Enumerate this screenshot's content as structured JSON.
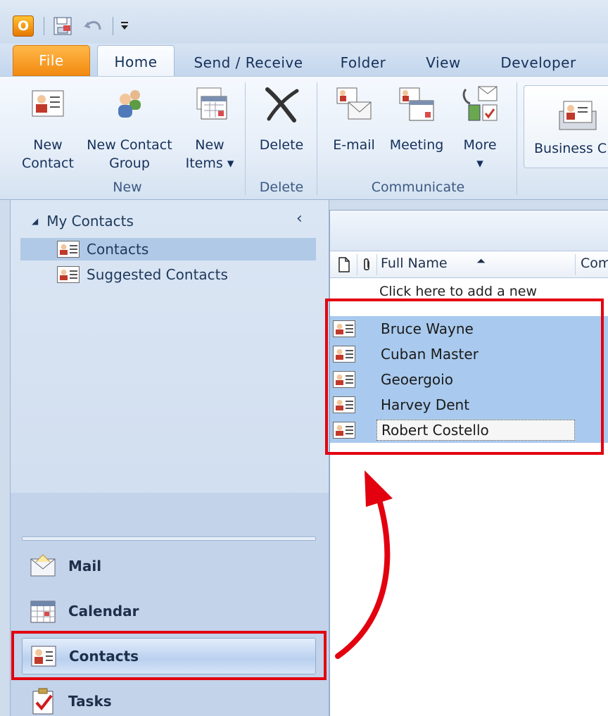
{
  "qat": {
    "app_icon": "outlook-logo-icon",
    "save_icon": "save-icon",
    "undo_icon": "undo-icon",
    "customize_icon": "customize-arrow-icon"
  },
  "tabs": [
    {
      "label": "File"
    },
    {
      "label": "Home"
    },
    {
      "label": "Send / Receive"
    },
    {
      "label": "Folder"
    },
    {
      "label": "View"
    },
    {
      "label": "Developer"
    }
  ],
  "ribbon": {
    "new_group": {
      "label": "New",
      "new_contact": "New\nContact",
      "new_contact_group": "New Contact\nGroup",
      "new_items": "New\nItems ▾"
    },
    "delete_group": {
      "label": "Delete",
      "delete": "Delete"
    },
    "communicate_group": {
      "label": "Communicate",
      "email": "E-mail",
      "meeting": "Meeting",
      "more": "More\n▾"
    },
    "business_card": "Business C"
  },
  "nav": {
    "header": "My Contacts",
    "collapse": "‹",
    "folders": [
      {
        "label": "Contacts"
      },
      {
        "label": "Suggested Contacts"
      }
    ],
    "buttons": [
      {
        "label": "Mail"
      },
      {
        "label": "Calendar"
      },
      {
        "label": "Contacts"
      },
      {
        "label": "Tasks"
      }
    ]
  },
  "list": {
    "columns": {
      "full_name": "Full Name",
      "sort_indicator": "⏶",
      "company": "Com"
    },
    "add_new": "Click here to add a new",
    "rows": [
      {
        "name": "Bruce Wayne"
      },
      {
        "name": "Cuban Master"
      },
      {
        "name": "Geoergoio"
      },
      {
        "name": "Harvey Dent"
      },
      {
        "name": "Robert Costello"
      }
    ]
  },
  "colors": {
    "accent_file_tab": "#f28a10",
    "selection": "#a9caee",
    "annotation_red": "#e3000f"
  }
}
